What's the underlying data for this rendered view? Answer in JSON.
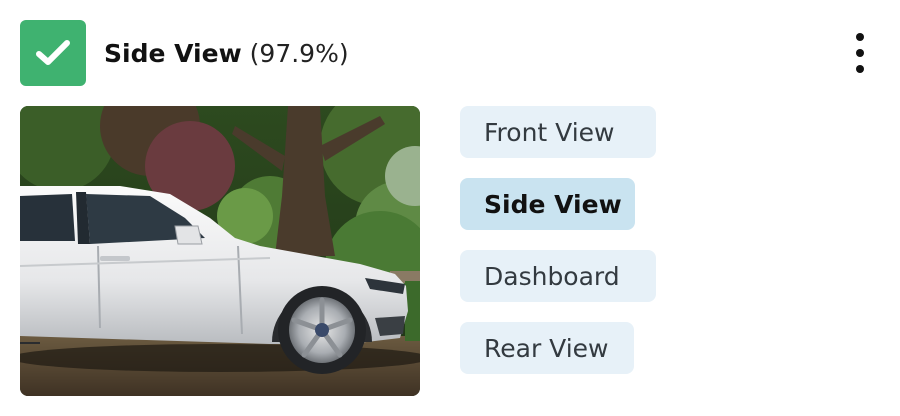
{
  "header": {
    "label": "Side View",
    "score": "(97.9%)"
  },
  "image": {
    "subject": "white sedan side view"
  },
  "options": [
    {
      "label": "Front View",
      "selected": false
    },
    {
      "label": "Side View",
      "selected": true
    },
    {
      "label": "Dashboard",
      "selected": false
    },
    {
      "label": "Rear View",
      "selected": false
    }
  ],
  "colors": {
    "accent_green": "#3fb270",
    "option_bg": "#e7f1f8",
    "option_selected_bg": "#c9e3f0",
    "text": "#111111"
  },
  "icons": {
    "status": "checkmark-icon",
    "menu": "more-vertical-icon"
  }
}
